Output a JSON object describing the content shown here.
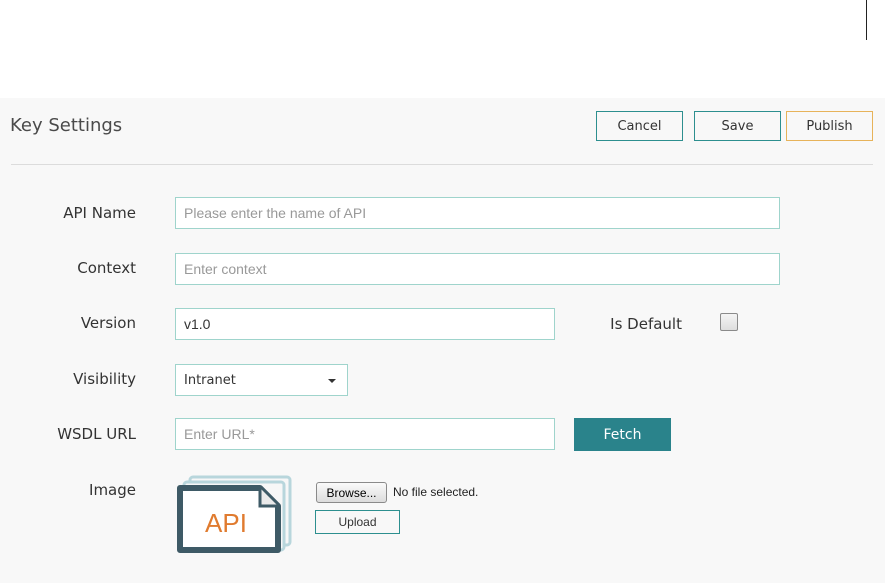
{
  "page": {
    "title": "Key Settings",
    "buttons": {
      "cancel": "Cancel",
      "save": "Save",
      "publish": "Publish"
    }
  },
  "form": {
    "api_name": {
      "label": "API Name",
      "value": "",
      "placeholder": "Please enter the name of API"
    },
    "context": {
      "label": "Context",
      "value": "",
      "placeholder": "Enter context"
    },
    "version": {
      "label": "Version",
      "value": "v1.0",
      "placeholder": ""
    },
    "is_default": {
      "label": "Is Default",
      "checked": false
    },
    "visibility": {
      "label": "Visibility",
      "selected": "Intranet"
    },
    "wsdl_url": {
      "label": "WSDL URL",
      "value": "",
      "placeholder": "Enter URL*",
      "fetch_label": "Fetch"
    },
    "image": {
      "label": "Image",
      "browse_label": "Browse...",
      "file_status": "No file selected.",
      "upload_label": "Upload",
      "thumbnail_text": "API"
    }
  },
  "colors": {
    "accent_teal": "#2a838b",
    "input_border": "#9fd4cc",
    "publish_border": "#e7b35a",
    "api_text": "#e07b2f",
    "api_frame": "#3e5a66"
  }
}
